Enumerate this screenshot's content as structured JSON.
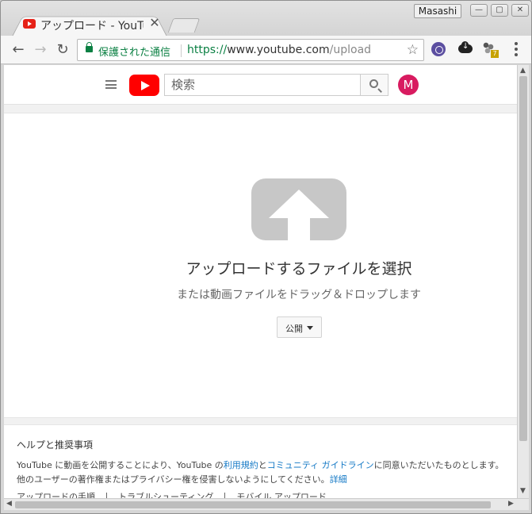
{
  "window": {
    "user": "Masashi",
    "minimize": "—",
    "maximize": "▢",
    "close": "✕"
  },
  "tab": {
    "title": "アップロード - YouTube",
    "close": "✕"
  },
  "toolbar": {
    "back": "←",
    "forward": "→",
    "reload": "↻",
    "secure_label": "保護された通信",
    "url_scheme": "https://",
    "url_host": "www.youtube.com",
    "url_path": "/upload",
    "star": "☆",
    "ext_badge": "7"
  },
  "youtube": {
    "search_placeholder": "検索",
    "avatar_letter": "M"
  },
  "upload": {
    "title": "アップロードするファイルを選択",
    "subtitle": "または動画ファイルをドラッグ＆ドロップします",
    "privacy_label": "公開"
  },
  "help": {
    "title": "ヘルプと推奨事項",
    "line1_a": "YouTube に動画を公開することにより、YouTube の",
    "terms_link": "利用規約",
    "line1_b": "と",
    "guidelines_link": "コミュニティ ガイドライン",
    "line1_c": "に同意いただいたものとします。",
    "line2": "他のユーザーの著作権またはプライバシー権を侵害しないようにしてください。",
    "details_link": "詳細",
    "links": [
      "アップロードの手順",
      "トラブルシューティング",
      "モバイル アップロード"
    ]
  },
  "scrollbar": {
    "up": "▲",
    "down": "▼",
    "left": "◀",
    "right": "▶"
  }
}
